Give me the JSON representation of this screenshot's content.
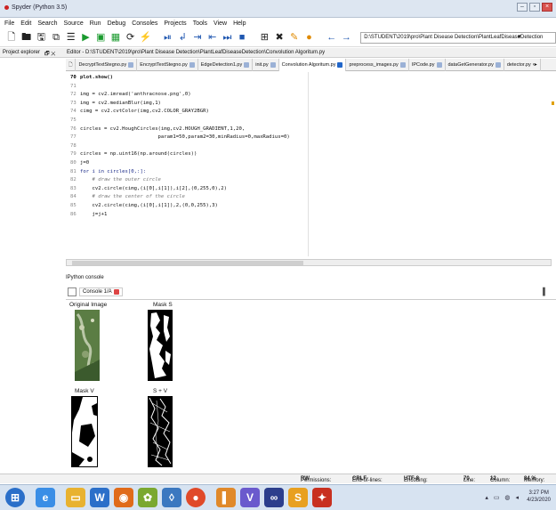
{
  "window": {
    "title": "Spyder (Python 3.5)",
    "buttons": [
      "–",
      "▫",
      "×"
    ]
  },
  "menu": [
    "File",
    "Edit",
    "Search",
    "Source",
    "Run",
    "Debug",
    "Consoles",
    "Projects",
    "Tools",
    "View",
    "Help"
  ],
  "toolbar": {
    "path": "D:\\STUDENT\\2019\\pro\\Plant Disease Detection\\PlantLeafDiseaseDetection"
  },
  "pane_header": {
    "project_explorer": "Project explorer",
    "editor_label": "Editor - D:\\STUDENT\\2019\\pro\\Plant Disease Detection\\PlantLeafDiseaseDetection\\Convolution Algoritum.py"
  },
  "tabs": [
    {
      "label": "DecryptTextStegno.py",
      "active": false
    },
    {
      "label": "EncryptTextStegno.py",
      "active": false
    },
    {
      "label": "EdgeDetection1.py",
      "active": false
    },
    {
      "label": "init.py",
      "active": false
    },
    {
      "label": "Convolution Algoritum.py",
      "active": true
    },
    {
      "label": "preprocess_images.py",
      "active": false
    },
    {
      "label": "IPCode.py",
      "active": false
    },
    {
      "label": "dataGetGenerator.py",
      "active": false
    },
    {
      "label": "detector.py",
      "active": false
    }
  ],
  "code_lines": [
    {
      "num": "70",
      "text": "plot.show()",
      "style": "bold"
    },
    {
      "num": "71",
      "text": "",
      "style": ""
    },
    {
      "num": "72",
      "text": "img = cv2.imread('anthracnose.png',0)",
      "style": ""
    },
    {
      "num": "73",
      "text": "img = cv2.medianBlur(img,1)",
      "style": ""
    },
    {
      "num": "74",
      "text": "cimg = cv2.cvtColor(img,cv2.COLOR_GRAY2BGR)",
      "style": ""
    },
    {
      "num": "75",
      "text": "",
      "style": ""
    },
    {
      "num": "76",
      "text": "circles = cv2.HoughCircles(img,cv2.HOUGH_GRADIENT,1,20,",
      "style": ""
    },
    {
      "num": "77",
      "text": "                          param1=50,param2=30,minRadius=0,maxRadius=0)",
      "style": ""
    },
    {
      "num": "78",
      "text": "",
      "style": ""
    },
    {
      "num": "79",
      "text": "circles = np.uint16(np.around(circles))",
      "style": ""
    },
    {
      "num": "80",
      "text": "j=0",
      "style": ""
    },
    {
      "num": "81",
      "text": "for i in circles[0,:]:",
      "style": "kw"
    },
    {
      "num": "82",
      "text": "    # draw the outer circle",
      "style": "comment"
    },
    {
      "num": "83",
      "text": "    cv2.circle(cimg,(i[0],i[1]),i[2],(0,255,0),2)",
      "style": ""
    },
    {
      "num": "84",
      "text": "    # draw the center of the circle",
      "style": "comment"
    },
    {
      "num": "85",
      "text": "    cv2.circle(cimg,(i[0],i[1]),2,(0,0,255),3)",
      "style": ""
    },
    {
      "num": "86",
      "text": "    j=j+1",
      "style": ""
    }
  ],
  "console": {
    "header": "IPython console",
    "tab_label": "Console 1/A",
    "figures": [
      {
        "label": "Original Image"
      },
      {
        "label": "Mask S"
      },
      {
        "label": "Mask V"
      },
      {
        "label": "S + V"
      }
    ]
  },
  "status": {
    "permissions_label": "Permissions:",
    "permissions": "RW",
    "eol_label": "End-of-lines:",
    "eol": "CRLF",
    "encoding_label": "Encoding:",
    "encoding": "UTF-8",
    "line_label": "Line:",
    "line": "70",
    "column_label": "Column:",
    "column": "12",
    "memory_label": "Memory:",
    "memory": "84 %"
  },
  "taskbar": {
    "clock_time": "3:27 PM",
    "clock_date": "4/23/2020"
  },
  "colors": {
    "accent": "#2166c9",
    "title_bg": "#dde6f1",
    "taskbar_bg": "#d7e3f1"
  }
}
